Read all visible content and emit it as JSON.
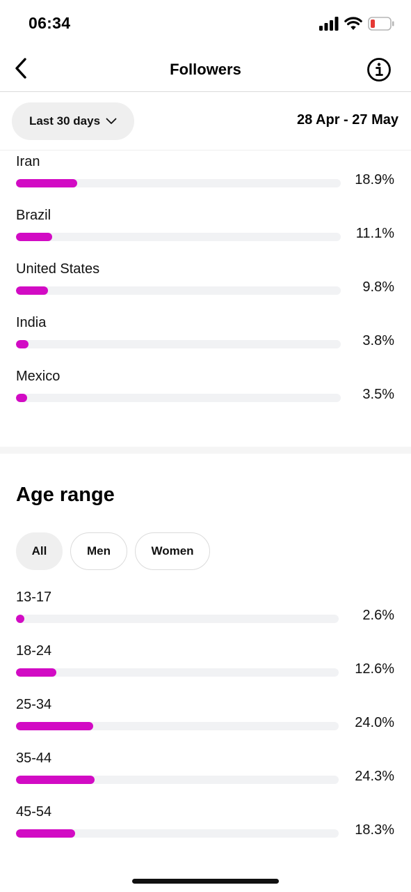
{
  "status_bar": {
    "time": "06:34",
    "icons": [
      "signal-icon",
      "wifi-icon",
      "battery-icon"
    ],
    "battery_color": "#e53935"
  },
  "nav": {
    "title": "Followers",
    "back_icon": "chevron-left-icon",
    "info_icon": "info-icon"
  },
  "filter": {
    "period_label": "Last 30 days",
    "date_range": "28 Apr - 27 May"
  },
  "locations": [
    {
      "label": "Iran",
      "value": "18.9%",
      "fill_fraction": 0.189
    },
    {
      "label": "Brazil",
      "value": "11.1%",
      "fill_fraction": 0.111
    },
    {
      "label": "United States",
      "value": "9.8%",
      "fill_fraction": 0.098
    },
    {
      "label": "India",
      "value": "3.8%",
      "fill_fraction": 0.038
    },
    {
      "label": "Mexico",
      "value": "3.5%",
      "fill_fraction": 0.035
    }
  ],
  "age_range": {
    "title": "Age range",
    "tabs": [
      {
        "label": "All",
        "selected": true
      },
      {
        "label": "Men",
        "selected": false
      },
      {
        "label": "Women",
        "selected": false
      }
    ],
    "rows": [
      {
        "label": "13-17",
        "value": "2.6%",
        "fill_fraction": 0.026
      },
      {
        "label": "18-24",
        "value": "12.6%",
        "fill_fraction": 0.126
      },
      {
        "label": "25-34",
        "value": "24.0%",
        "fill_fraction": 0.24
      },
      {
        "label": "35-44",
        "value": "24.3%",
        "fill_fraction": 0.243
      },
      {
        "label": "45-54",
        "value": "18.3%",
        "fill_fraction": 0.183
      }
    ]
  },
  "colors": {
    "bar_fill": "#d20bc4",
    "bar_track": "#f1f2f4",
    "pill_bg": "#efefef"
  }
}
